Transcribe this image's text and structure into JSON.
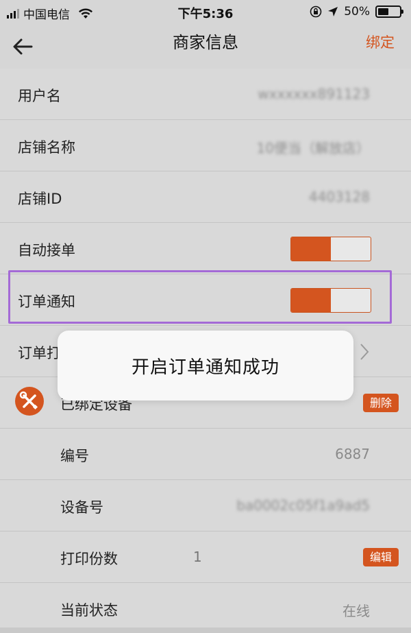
{
  "status_bar": {
    "carrier": "中国电信",
    "time": "下午5:36",
    "battery_percent": "50%",
    "battery_level": 0.5
  },
  "nav": {
    "title": "商家信息",
    "action": "绑定"
  },
  "rows": {
    "username": {
      "label": "用户名",
      "value": "wxxxxxx891123"
    },
    "store_name": {
      "label": "店铺名称",
      "value": "10便当（解放店）"
    },
    "store_id": {
      "label": "店铺ID",
      "value": "4403128"
    },
    "auto_accept": {
      "label": "自动接单",
      "on": true
    },
    "order_notify": {
      "label": "订单通知",
      "on": true
    },
    "order_print": {
      "label": "订单打印"
    },
    "bound_device": {
      "label": "已绑定设备",
      "action": "删除"
    },
    "number": {
      "label": "编号",
      "value": "6887"
    },
    "device_no": {
      "label": "设备号",
      "value": "ba0002c05f1a9ad5"
    },
    "print_copies": {
      "label": "打印份数",
      "value": "1",
      "action": "编辑"
    },
    "current_status": {
      "label": "当前状态",
      "value": "在线"
    }
  },
  "toast": {
    "message": "开启订单通知成功"
  },
  "colors": {
    "accent": "#d4551f",
    "highlight": "#a46ad6",
    "background": "#d9d9d9"
  },
  "icons": [
    "signal-icon",
    "wifi-icon",
    "orientation-lock-icon",
    "location-arrow-icon",
    "battery-icon",
    "back-arrow-icon",
    "chevron-right-icon",
    "tools-icon"
  ]
}
